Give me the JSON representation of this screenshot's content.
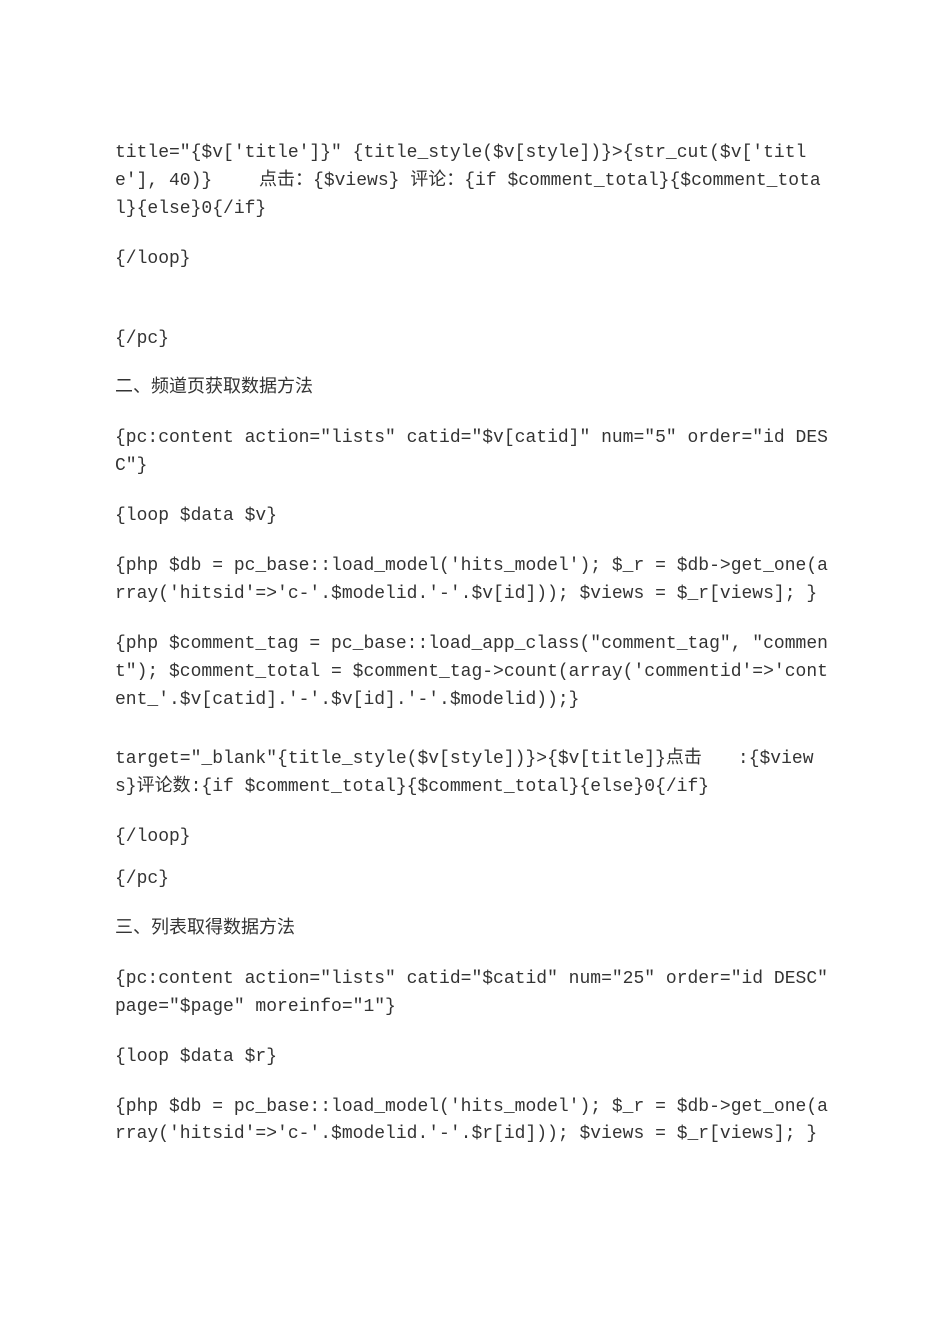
{
  "p1": "title=\"{$v['title']}\" {title_style($v[style])}>{str_cut($v['title'], 40)}　　 点击：{$views} 评论：{if $comment_total}{$comment_total}{else}0{/if}",
  "p2": "{/loop}",
  "p3": "{/pc}",
  "h2": "二、频道页获取数据方法",
  "p4": "{pc:content action=\"lists\" catid=\"$v[catid]\" num=\"5″ order=\"id DESC\"}",
  "p5": "{loop $data $v}",
  "p6": "{php $db = pc_base::load_model('hits_model'); $_r = $db->get_one(array('hitsid'=>'c-'.$modelid.'-'.$v[id])); $views = $_r[views]; }",
  "p7": "{php $comment_tag = pc_base::load_app_class(\"comment_tag\", \"comment\"); $comment_total = $comment_tag->count(array('commentid'=>'content_'.$v[catid].'-'.$v[id].'-'.$modelid));}",
  "p8": "target=\"_blank\"{title_style($v[style])}>{$v[title]}点击　　:{$views}评论数:{if $comment_total}{$comment_total}{else}0{/if}",
  "p9": "{/loop}",
  "p10": "{/pc}",
  "h3": "三、列表取得数据方法",
  "p11": "{pc:content action=\"lists\" catid=\"$catid\" num=\"25″ order=\"id DESC\" page=\"$page\" moreinfo=\"1″}",
  "p12": "{loop $data $r}",
  "p13": "{php $db = pc_base::load_model('hits_model'); $_r = $db->get_one(array('hitsid'=>'c-'.$modelid.'-'.$r[id])); $views = $_r[views]; }"
}
